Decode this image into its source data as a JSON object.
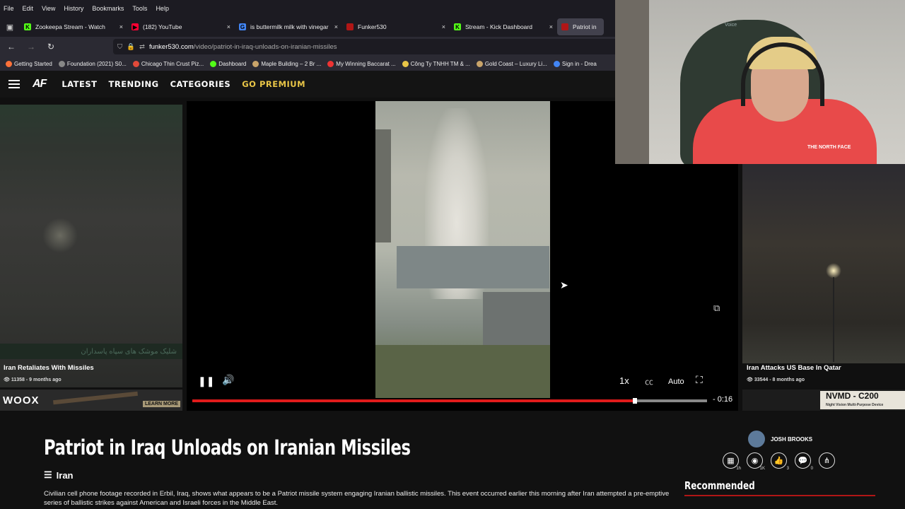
{
  "browser": {
    "menu": [
      "File",
      "Edit",
      "View",
      "History",
      "Bookmarks",
      "Tools",
      "Help"
    ],
    "tabs": [
      {
        "title": "Zookeepa Stream - Watch",
        "fav_color": "#53fc18",
        "fav_glyph": "K"
      },
      {
        "title": "(182) YouTube",
        "fav_color": "#ff0033",
        "fav_glyph": "▶"
      },
      {
        "title": "is buttermilk milk with vinegar",
        "fav_color": "#4285f4",
        "fav_glyph": "G"
      },
      {
        "title": "Funker530",
        "fav_color": "#b01616",
        "fav_glyph": ""
      },
      {
        "title": "Stream - Kick Dashboard",
        "fav_color": "#53fc18",
        "fav_glyph": "K"
      },
      {
        "title": "Patriot in",
        "fav_color": "#b01616",
        "fav_glyph": ""
      }
    ],
    "url": {
      "host": "funker530.com",
      "path": "/video/patriot-in-iraq-unloads-on-iranian-missiles"
    },
    "bookmarks": [
      {
        "label": "Getting Started",
        "color": "#ff7139"
      },
      {
        "label": "Foundation (2021) S0...",
        "color": "#888888"
      },
      {
        "label": "Chicago Thin Crust Piz...",
        "color": "#e24a3a"
      },
      {
        "label": "Dashboard",
        "color": "#53fc18"
      },
      {
        "label": "Maple Building – 2 Br ...",
        "color": "#c9a46a"
      },
      {
        "label": "My Winning Baccarat ...",
        "color": "#e33"
      },
      {
        "label": "Công Ty TNHH TM & ...",
        "color": "#e8c547"
      },
      {
        "label": "Gold Coast – Luxury Li...",
        "color": "#c9a46a"
      },
      {
        "label": "Sign in - Drea",
        "color": "#4285f4"
      }
    ]
  },
  "site": {
    "logo": "AF",
    "nav": [
      "LATEST",
      "TRENDING",
      "CATEGORIES"
    ],
    "premium": "GO PREMIUM"
  },
  "left_card": {
    "title": "Iran Retaliates With Missiles",
    "meta": "👁 11358 - 9 months ago",
    "overlay": "شلیک موشک های سپاه پاسداران"
  },
  "right_card": {
    "title": "Iran Attacks US Base In Qatar",
    "meta": "👁 33544 - 8 months ago"
  },
  "ads": {
    "left_brand": "WOOX",
    "left_cta": "LEARN MORE",
    "right_brand": "NVMD - C200",
    "right_sub": "Night Vision Multi-Purpose Device"
  },
  "player": {
    "speed": "1x",
    "quality": "Auto",
    "time_remaining": "- 0:16",
    "progress": 0.86
  },
  "article": {
    "title": "Patriot in Iraq Unloads on Iranian Missiles",
    "category": "Iran",
    "description": "Civilian cell phone footage recorded in Erbil, Iraq, shows what appears to be a Patriot missile system engaging Iranian ballistic missiles. This event occurred earlier this morning after Iran attempted a pre-emptive series of ballistic strikes against American and Israeli forces in the Middle East.",
    "author": "JOSH BROOKS",
    "stats": [
      {
        "icon": "calendar-icon",
        "glyph": "▦",
        "count": "1h"
      },
      {
        "icon": "eye-icon",
        "glyph": "◉",
        "count": "1K"
      },
      {
        "icon": "thumbs-up-icon",
        "glyph": "👍",
        "count": "3"
      },
      {
        "icon": "comment-icon",
        "glyph": "💬",
        "count": "0"
      },
      {
        "icon": "share-icon",
        "glyph": "⋔",
        "count": ""
      }
    ],
    "recommended": "Recommended"
  },
  "webcam": {
    "chair_text": "Voice",
    "shirt_brand": "THE NORTH FACE"
  }
}
